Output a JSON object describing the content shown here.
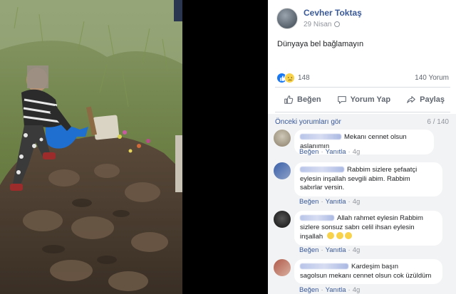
{
  "post": {
    "author": "Cevher Toktaş",
    "date": "29 Nisan",
    "text": "Dünyaya bel bağlamayın",
    "reaction_count": "148",
    "comment_count": "140 Yorum"
  },
  "actions": {
    "like": "Beğen",
    "comment": "Yorum Yap",
    "share": "Paylaş"
  },
  "comments_section": {
    "previous_link": "Önceki yorumları gör",
    "paging": "6 / 140"
  },
  "comments": [
    {
      "line1": "Mekanı cennet olsun aslanımın",
      "line2": "",
      "line3": "",
      "like": "Beğen",
      "reply": "Yanıtla",
      "time": "4g"
    },
    {
      "line1": "Rabbim sizlere şefaatçi",
      "line2": "eylesin inşallah sevgili abim. Rabbim",
      "line3": "sabırlar versin.",
      "like": "Beğen",
      "reply": "Yanıtla",
      "time": "4g"
    },
    {
      "line1": "Allah rahmet eylesin Rabbim",
      "line2": "sizlere sonsuz sabrı celil ihsan eylesin",
      "line3": "inşallah",
      "like": "Beğen",
      "reply": "Yanıtla",
      "time": "4g"
    },
    {
      "line1": "Kardeşim başın",
      "line2": "sagolsun mekanı cennet olsun cok üzüldüm",
      "line3": "",
      "like": "Beğen",
      "reply": "Yanıtla",
      "time": "4g"
    }
  ],
  "colors": {
    "link": "#385898",
    "muted": "#90949c",
    "comment_bg": "#f2f3f5",
    "like_blue": "#1877f2"
  },
  "icons": [
    "like-icon",
    "comment-icon",
    "share-icon",
    "globe-icon",
    "sad-emoji-icon"
  ]
}
